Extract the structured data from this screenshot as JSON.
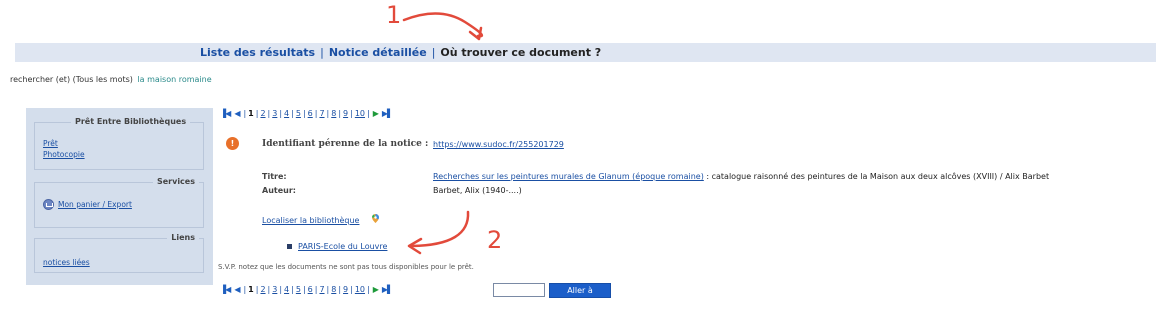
{
  "nav": {
    "tabs": [
      {
        "label": "Liste des résultats",
        "current": false
      },
      {
        "label": "Notice détaillée",
        "current": false
      },
      {
        "label": "Où trouver ce document ?",
        "current": true
      }
    ],
    "separator": "|"
  },
  "search": {
    "prefix": "rechercher (et) (Tous les mots)",
    "terms": "la maison romaine"
  },
  "sidebar": {
    "peb": {
      "title": "Prêt Entre Bibliothèques",
      "links": [
        "Prêt",
        "Photocopie"
      ]
    },
    "services": {
      "title": "Services",
      "basket_label": "Mon panier / Export"
    },
    "liens": {
      "title": "Liens",
      "links": [
        "notices liées"
      ]
    }
  },
  "pagination": {
    "current": "1",
    "pages": [
      "2",
      "3",
      "4",
      "5",
      "6",
      "7",
      "8",
      "9",
      "10"
    ]
  },
  "notice": {
    "badge": "!",
    "id_label": "Identifiant pérenne de la notice :",
    "id_url": "https://www.sudoc.fr/255201729",
    "title_label": "Titre:",
    "title_link": "Recherches sur les peintures murales de Glanum (époque romaine)",
    "title_rest": " : catalogue raisonné des peintures de la Maison aux deux alcôves (XVIII) / Alix Barbet",
    "author_label": "Auteur:",
    "author_value": "Barbet, Alix (1940-....)",
    "locate_label": "Localiser la bibliothèque",
    "library": "PARIS-Ecole du Louvre",
    "note": "S.V.P. notez que les documents ne sont pas tous disponibles pour le prêt."
  },
  "goto": {
    "input_value": "",
    "button_label": "Aller à"
  },
  "annotations": {
    "first": "1",
    "second": "2",
    "color": "#e24a3b"
  },
  "colors": {
    "nav_bg": "#dfe6f2",
    "sidebar_bg": "#d4deec",
    "link": "#1a4fa3",
    "button": "#1b5ec9"
  }
}
